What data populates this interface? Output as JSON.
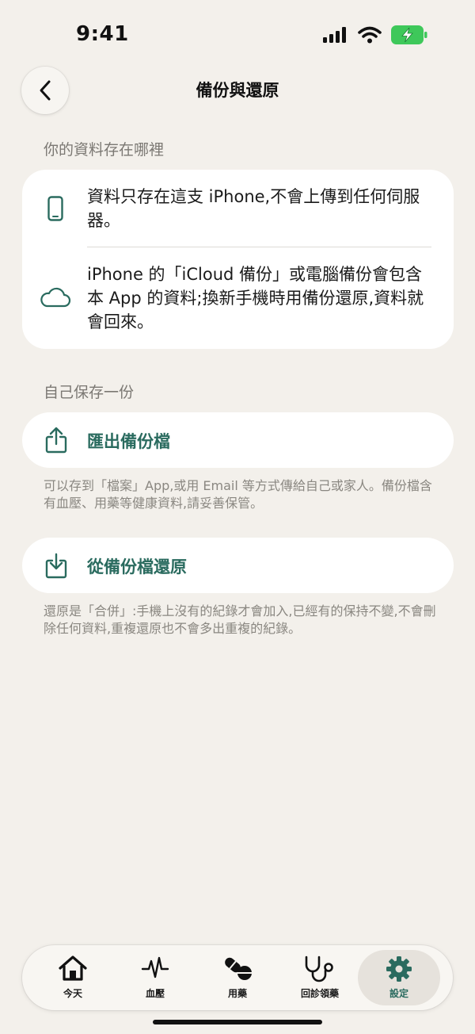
{
  "status_bar": {
    "time": "9:41"
  },
  "header": {
    "title": "備份與還原"
  },
  "sections": {
    "storage": {
      "header": "你的資料存在哪裡",
      "items": [
        {
          "icon": "iphone-icon",
          "text": "資料只存在這支 iPhone,不會上傳到任何伺服器。"
        },
        {
          "icon": "cloud-icon",
          "text": "iPhone 的「iCloud 備份」或電腦備份會包含本 App 的資料;換新手機時用備份還原,資料就會回來。"
        }
      ]
    },
    "backup": {
      "header": "自己保存一份",
      "export": {
        "icon": "share-icon",
        "label": "匯出備份檔",
        "note": "可以存到「檔案」App,或用 Email 等方式傳給自己或家人。備份檔含有血壓、用藥等健康資料,請妥善保管。"
      },
      "restore": {
        "icon": "download-icon",
        "label": "從備份檔還原",
        "note": "還原是「合併」:手機上沒有的紀錄才會加入,已經有的保持不變,不會刪除任何資料,重複還原也不會多出重複的紀錄。"
      }
    }
  },
  "tab_bar": {
    "tabs": [
      {
        "icon": "house-icon",
        "label": "今天"
      },
      {
        "icon": "heartbeat-icon",
        "label": "血壓"
      },
      {
        "icon": "pills-icon",
        "label": "用藥"
      },
      {
        "icon": "stethoscope-icon",
        "label": "回診領藥"
      },
      {
        "icon": "gear-icon",
        "label": "設定"
      }
    ],
    "active_index": 4
  },
  "colors": {
    "background": "#f3f0eb",
    "card": "#ffffff",
    "accent": "#2a6b5f",
    "secondary_text": "#7b7873",
    "battery": "#3ec85a"
  }
}
